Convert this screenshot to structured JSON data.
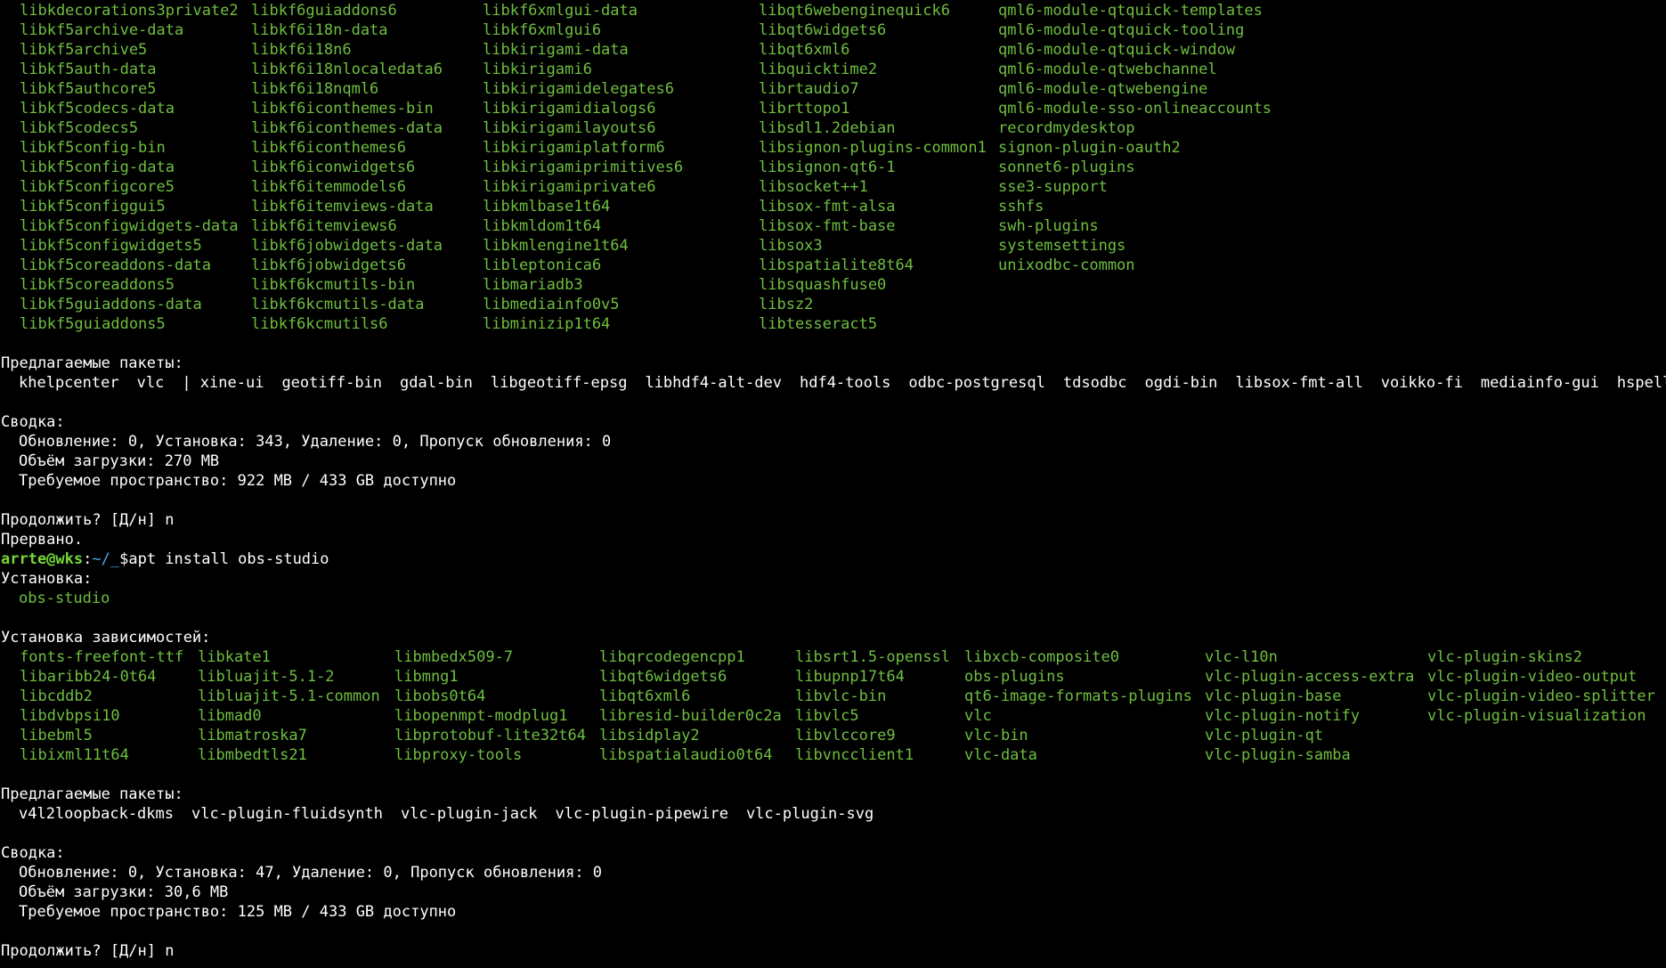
{
  "colors": {
    "background": "#000000",
    "text": "#ffffff",
    "package": "#6fbf40",
    "prompt_user": "#76d73a",
    "prompt_path": "#4ea7e8"
  },
  "top_columns": [
    [
      "libkdecorations3private2",
      "libkf5archive-data",
      "libkf5archive5",
      "libkf5auth-data",
      "libkf5authcore5",
      "libkf5codecs-data",
      "libkf5codecs5",
      "libkf5config-bin",
      "libkf5config-data",
      "libkf5configcore5",
      "libkf5configgui5",
      "libkf5configwidgets-data",
      "libkf5configwidgets5",
      "libkf5coreaddons-data",
      "libkf5coreaddons5",
      "libkf5guiaddons-data",
      "libkf5guiaddons5"
    ],
    [
      "libkf6guiaddons6",
      "libkf6i18n-data",
      "libkf6i18n6",
      "libkf6i18nlocaledata6",
      "libkf6i18nqml6",
      "libkf6iconthemes-bin",
      "libkf6iconthemes-data",
      "libkf6iconthemes6",
      "libkf6iconwidgets6",
      "libkf6itemmodels6",
      "libkf6itemviews-data",
      "libkf6itemviews6",
      "libkf6jobwidgets-data",
      "libkf6jobwidgets6",
      "libkf6kcmutils-bin",
      "libkf6kcmutils-data",
      "libkf6kcmutils6"
    ],
    [
      "libkf6xmlgui-data",
      "libkf6xmlgui6",
      "libkirigami-data",
      "libkirigami6",
      "libkirigamidelegates6",
      "libkirigamidialogs6",
      "libkirigamilayouts6",
      "libkirigamiplatform6",
      "libkirigamiprimitives6",
      "libkirigamiprivate6",
      "libkmlbase1t64",
      "libkmldom1t64",
      "libkmlengine1t64",
      "libleptonica6",
      "libmariadb3",
      "libmediainfo0v5",
      "libminizip1t64"
    ],
    [
      "libqt6webenginequick6",
      "libqt6widgets6",
      "libqt6xml6",
      "libquicktime2",
      "librtaudio7",
      "librttopo1",
      "libsdl1.2debian",
      "libsignon-plugins-common1",
      "libsignon-qt6-1",
      "libsocket++1",
      "libsox-fmt-alsa",
      "libsox-fmt-base",
      "libsox3",
      "libspatialite8t64",
      "libsquashfuse0",
      "libsz2",
      "libtesseract5"
    ],
    [
      "qml6-module-qtquick-templates",
      "qml6-module-qtquick-tooling",
      "qml6-module-qtquick-window",
      "qml6-module-qtwebchannel",
      "qml6-module-qtwebengine",
      "qml6-module-sso-onlineaccounts",
      "recordmydesktop",
      "signon-plugin-oauth2",
      "sonnet6-plugins",
      "sse3-support",
      "sshfs",
      "swh-plugins",
      "systemsettings",
      "unixodbc-common"
    ]
  ],
  "section1": {
    "suggested_header": "Предлагаемые пакеты:",
    "suggested": [
      "khelpcenter",
      "vlc",
      "| xine-ui",
      "geotiff-bin",
      "gdal-bin",
      "libgeotiff-epsg",
      "libhdf4-alt-dev",
      "hdf4-tools",
      "odbc-postgresql",
      "tdsodbc",
      "ogdi-bin",
      "libsox-fmt-all",
      "voikko-fi",
      "mediainfo-gui",
      "hspell"
    ],
    "summary_header": "Сводка:",
    "summary_line1": "Обновление: 0, Установка: 343, Удаление: 0, Пропуск обновления: 0",
    "summary_line2": "Объём загрузки: 270 MB",
    "summary_line3": "Требуемое пространство: 922 MB / 433 GB доступно",
    "continue_prompt": "Продолжить? [Д/н] n",
    "aborted": "Прервано."
  },
  "prompt": {
    "user": "arrte@wks",
    "sep": ":",
    "path": "~/_",
    "symbol": "$",
    "command": "apt install obs-studio"
  },
  "section2": {
    "install_header": "Установка:",
    "install_package": "obs-studio",
    "deps_header": "Установка зависимостей:",
    "deps_columns": [
      [
        "fonts-freefont-ttf",
        "libaribb24-0t64",
        "libcddb2",
        "libdvbpsi10",
        "libebml5",
        "libixml11t64"
      ],
      [
        "libkate1",
        "libluajit-5.1-2",
        "libluajit-5.1-common",
        "libmad0",
        "libmatroska7",
        "libmbedtls21"
      ],
      [
        "libmbedx509-7",
        "libmng1",
        "libobs0t64",
        "libopenmpt-modplug1",
        "libprotobuf-lite32t64",
        "libproxy-tools"
      ],
      [
        "libqrcodegencpp1",
        "libqt6widgets6",
        "libqt6xml6",
        "libresid-builder0c2a",
        "libsidplay2",
        "libspatialaudio0t64"
      ],
      [
        "libsrt1.5-openssl",
        "libupnp17t64",
        "libvlc-bin",
        "libvlc5",
        "libvlccore9",
        "libvncclient1"
      ],
      [
        "libxcb-composite0",
        "obs-plugins",
        "qt6-image-formats-plugins",
        "vlc",
        "vlc-bin",
        "vlc-data"
      ],
      [
        "vlc-l10n",
        "vlc-plugin-access-extra",
        "vlc-plugin-base",
        "vlc-plugin-notify",
        "vlc-plugin-qt",
        "vlc-plugin-samba"
      ],
      [
        "vlc-plugin-skins2",
        "vlc-plugin-video-output",
        "vlc-plugin-video-splitter",
        "vlc-plugin-visualization"
      ]
    ],
    "suggested_header": "Предлагаемые пакеты:",
    "suggested": [
      "v4l2loopback-dkms",
      "vlc-plugin-fluidsynth",
      "vlc-plugin-jack",
      "vlc-plugin-pipewire",
      "vlc-plugin-svg"
    ],
    "summary_header": "Сводка:",
    "summary_line1": "Обновление: 0, Установка: 47, Удаление: 0, Пропуск обновления: 0",
    "summary_line2": "Объём загрузки: 30,6 MB",
    "summary_line3": "Требуемое пространство: 125 MB / 433 GB доступно",
    "continue_prompt": "Продолжить? [Д/н] n"
  }
}
